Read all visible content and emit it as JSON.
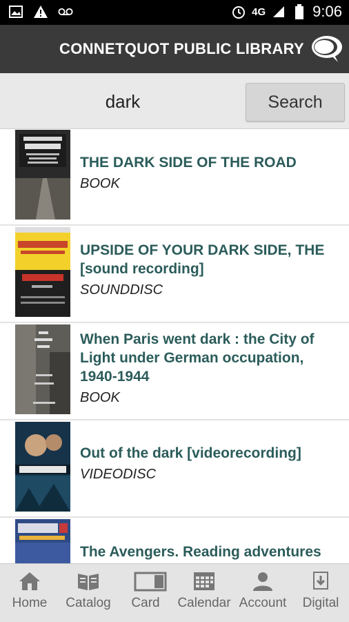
{
  "status": {
    "network": "4G",
    "time": "9:06"
  },
  "header": {
    "title": "CONNETQUOT PUBLIC LIBRARY"
  },
  "search": {
    "value": "dark",
    "button_label": "Search"
  },
  "results": [
    {
      "title": "THE DARK SIDE OF THE ROAD",
      "type": "BOOK"
    },
    {
      "title": "UPSIDE OF YOUR DARK SIDE, THE [sound recording]",
      "type": "SOUNDDISC"
    },
    {
      "title": "When Paris went dark : the City of Light under German occupation, 1940-1944",
      "type": "BOOK"
    },
    {
      "title": "Out of the dark [videorecording]",
      "type": "VIDEODISC"
    },
    {
      "title": "The Avengers. Reading adventures",
      "type": ""
    }
  ],
  "nav": [
    {
      "label": "Home",
      "icon": "home-icon"
    },
    {
      "label": "Catalog",
      "icon": "book-icon"
    },
    {
      "label": "Card",
      "icon": "card-icon"
    },
    {
      "label": "Calendar",
      "icon": "calendar-icon"
    },
    {
      "label": "Account",
      "icon": "person-icon"
    },
    {
      "label": "Digital",
      "icon": "download-icon"
    }
  ],
  "colors": {
    "header_bg": "#3a3a3a",
    "title_teal": "#2b5c5a",
    "nav_bg": "#e4e4e4"
  }
}
